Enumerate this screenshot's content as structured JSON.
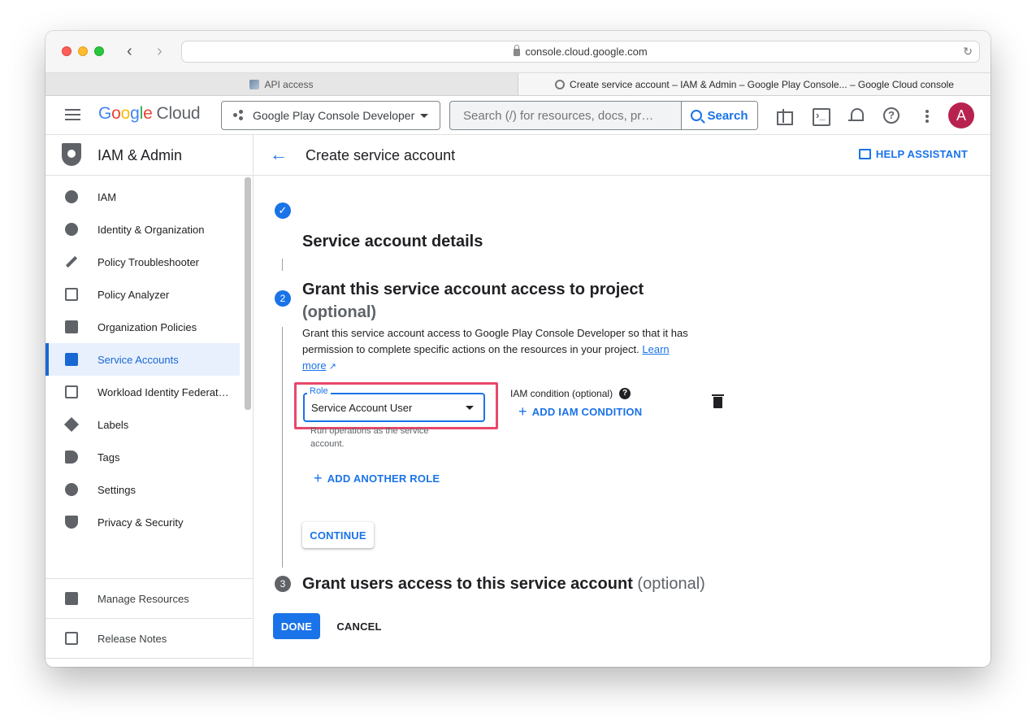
{
  "browser": {
    "url": "console.cloud.google.com",
    "tabs": [
      {
        "label": "API access"
      },
      {
        "label": "Create service account – IAM & Admin – Google Play Console... – Google Cloud console"
      }
    ]
  },
  "header": {
    "logo": {
      "google": "Google",
      "cloud": "Cloud"
    },
    "project": "Google Play Console Developer",
    "search_placeholder": "Search (/) for resources, docs, pr…",
    "search_label": "Search",
    "avatar_letter": "A"
  },
  "sidebar": {
    "title": "IAM & Admin",
    "items": [
      {
        "label": "IAM",
        "icon": "person-add-icon"
      },
      {
        "label": "Identity & Organization",
        "icon": "account-circle-icon"
      },
      {
        "label": "Policy Troubleshooter",
        "icon": "wrench-icon"
      },
      {
        "label": "Policy Analyzer",
        "icon": "policy-analyzer-icon"
      },
      {
        "label": "Organization Policies",
        "icon": "document-icon"
      },
      {
        "label": "Service Accounts",
        "icon": "service-account-icon",
        "active": true
      },
      {
        "label": "Workload Identity Federat…",
        "icon": "id-card-icon"
      },
      {
        "label": "Labels",
        "icon": "label-icon"
      },
      {
        "label": "Tags",
        "icon": "tag-icon"
      },
      {
        "label": "Settings",
        "icon": "gear-icon"
      },
      {
        "label": "Privacy & Security",
        "icon": "shield-icon"
      }
    ],
    "footer_items": [
      {
        "label": "Manage Resources",
        "icon": "manage-resources-icon"
      },
      {
        "label": "Release Notes",
        "icon": "release-notes-icon"
      }
    ],
    "collapse_label": "<I"
  },
  "main": {
    "title": "Create service account",
    "help_assistant": "HELP ASSISTANT",
    "step1": {
      "title": "Service account details"
    },
    "step2": {
      "number": "2",
      "title": "Grant this service account access to project",
      "optional": "(optional)",
      "description": "Grant this service account access to Google Play Console Developer so that it has permission to complete specific actions on the resources in your project.",
      "learn_more": "Learn more",
      "role_label": "Role",
      "role_value": "Service Account User",
      "role_help": "Run operations as the service account.",
      "iam_condition_label": "IAM condition (optional)",
      "add_iam_condition": "ADD IAM CONDITION",
      "add_another_role": "ADD ANOTHER ROLE",
      "continue": "CONTINUE"
    },
    "step3": {
      "number": "3",
      "title": "Grant users access to this service account",
      "optional": "(optional)"
    },
    "done": "DONE",
    "cancel": "CANCEL"
  },
  "colors": {
    "accent": "#1a73e8",
    "highlight": "#e8486a",
    "avatar": "#b8224f"
  }
}
